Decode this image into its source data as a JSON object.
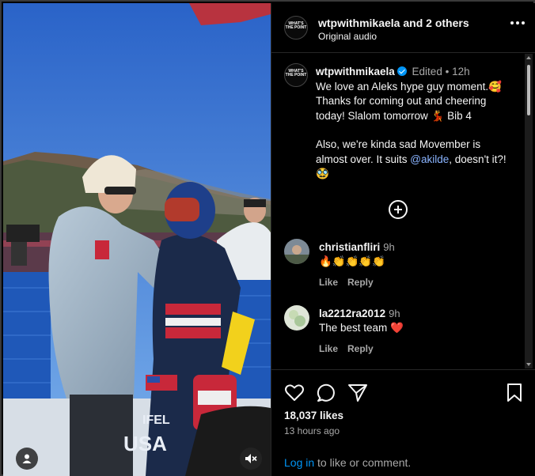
{
  "header": {
    "avatar_text": "WHAT'S THE POINT",
    "account": "wtpwithmikaela",
    "and_others": "and 2 others",
    "audio": "Original audio"
  },
  "caption": {
    "username": "wtpwithmikaela",
    "edited": "Edited",
    "separator": "•",
    "time": "12h",
    "line1": "We love an Aleks hype guy moment.🥰",
    "line2": "Thanks for coming out and cheering",
    "line3": "today! Slalom tomorrow 💃 Bib 4",
    "line4": "Also, we're kinda sad Movember is",
    "line5_pre": "almost over. It suits ",
    "mention": "@akilde",
    "line5_post": ", doesn't it?!",
    "line6": "🥸"
  },
  "comments": [
    {
      "user": "christianfliri",
      "time": "9h",
      "text": "🔥👏👏👏👏",
      "like": "Like",
      "reply": "Reply"
    },
    {
      "user": "la2212ra2012",
      "time": "9h",
      "text": "The best team ❤️",
      "like": "Like",
      "reply": "Reply"
    }
  ],
  "footer": {
    "likes": "18,037 likes",
    "posted": "13 hours ago",
    "login_link": "Log in",
    "login_suffix": " to like or comment."
  },
  "icons": {
    "like": "heart-icon",
    "comment": "comment-icon",
    "share": "send-icon",
    "save": "bookmark-icon",
    "more": "more-options-icon",
    "user": "user-tag-icon",
    "mute": "muted-speaker-icon",
    "add": "plus-circle-icon"
  },
  "colors": {
    "background": "#000000",
    "link": "#0095f6",
    "verified": "#0095f6",
    "muted_text": "#a8a8a8"
  }
}
